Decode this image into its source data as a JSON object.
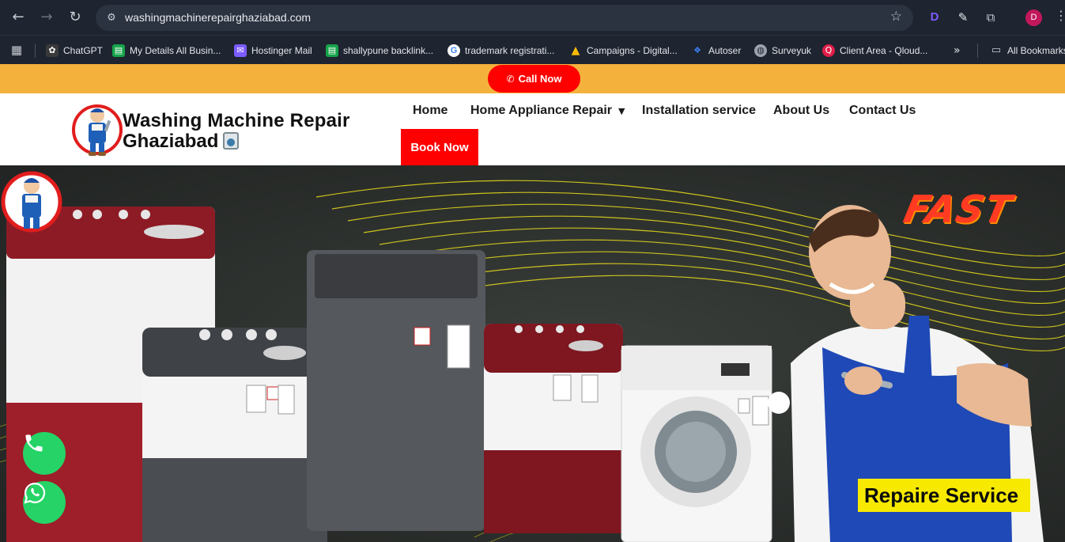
{
  "browser": {
    "url": "washingmachinerepairghaziabad.com",
    "profile_initial": "D",
    "nav_icons": [
      "back-icon",
      "forward-icon",
      "reload-icon"
    ],
    "bookmarks": [
      {
        "label": "ChatGPT",
        "icon": "chatgpt-icon",
        "color": "#2b2b2b"
      },
      {
        "label": "My Details All Busin...",
        "icon": "sheet-icon",
        "color": "#16a34a"
      },
      {
        "label": "Hostinger Mail",
        "icon": "mail-icon",
        "color": "#7c5cff"
      },
      {
        "label": "shallypune backlink...",
        "icon": "sheet-icon",
        "color": "#16a34a"
      },
      {
        "label": "trademark registrati...",
        "icon": "google-icon",
        "color": "#ffffff"
      },
      {
        "label": "Campaigns - Digital...",
        "icon": "google-ads-icon",
        "color": "#fbbc04"
      },
      {
        "label": "Autoser",
        "icon": "autoser-icon",
        "color": "#1e40af"
      },
      {
        "label": "Surveyuk",
        "icon": "globe-icon",
        "color": "#6b7280"
      },
      {
        "label": "Client Area - Qloud...",
        "icon": "qloud-icon",
        "color": "#e11d48"
      }
    ],
    "all_bookmarks": "All Bookmarks"
  },
  "site": {
    "call_now": "Call Now",
    "brand_line1": "Washing Machine Repair",
    "brand_line2": "Ghaziabad",
    "menu": {
      "home": "Home",
      "appliance": "Home Appliance Repair",
      "installation": "Installation service",
      "about": "About Us",
      "contact": "Contact Us"
    },
    "book_now": "Book Now",
    "hero": {
      "fast": "FAST",
      "badge": "Repaire Service"
    }
  },
  "colors": {
    "accent_red": "#ff0000",
    "topbar_yellow": "#f4b23c",
    "whatsapp_green": "#25d366",
    "badge_yellow": "#f7e900"
  }
}
